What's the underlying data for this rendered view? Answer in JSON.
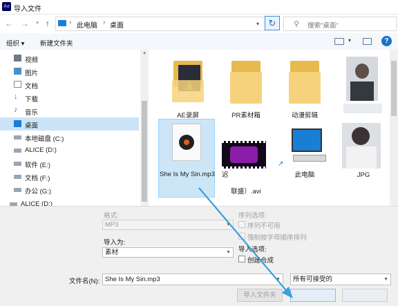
{
  "window": {
    "title": "导入文件",
    "app_icon_text": "Ae"
  },
  "address": {
    "crumbs": [
      "此电脑",
      "桌面"
    ],
    "separator": "›"
  },
  "search": {
    "placeholder": "搜索\"桌面\""
  },
  "toolbar": {
    "organize": "组织 ▾",
    "new_folder": "新建文件夹"
  },
  "sidebar": {
    "items": [
      {
        "label": "视频",
        "icon": "video-icon"
      },
      {
        "label": "图片",
        "icon": "pictures-icon"
      },
      {
        "label": "文档",
        "icon": "documents-icon"
      },
      {
        "label": "下载",
        "icon": "downloads-icon"
      },
      {
        "label": "音乐",
        "icon": "music-icon"
      },
      {
        "label": "桌面",
        "icon": "desktop-icon",
        "selected": true
      },
      {
        "label": "本地磁盘 (C:)",
        "icon": "drive-icon"
      },
      {
        "label": "ALICE (D:)",
        "icon": "drive-icon"
      },
      {
        "label": "软件 (E:)",
        "icon": "drive-icon"
      },
      {
        "label": "文档 (F:)",
        "icon": "drive-icon"
      },
      {
        "label": "办公 (G:)",
        "icon": "drive-icon"
      },
      {
        "label": "ALICE (D:)",
        "icon": "drive-icon"
      }
    ]
  },
  "files": [
    {
      "label": "AE录屏",
      "kind": "image-folder"
    },
    {
      "label": "PR素材箱",
      "kind": "folder"
    },
    {
      "label": "动漫剪辑",
      "kind": "folder"
    },
    {
      "label": "",
      "kind": "photo"
    },
    {
      "label": "She Is My Sin.mp3",
      "kind": "mp3",
      "selected": true
    },
    {
      "label": "迟",
      "label2": "联盛）.avi",
      "kind": "video"
    },
    {
      "label": "此电脑",
      "kind": "computer"
    },
    {
      "label": "JPG",
      "kind": "photo"
    }
  ],
  "options": {
    "format_label": "格式:",
    "format_value": "MP3",
    "import_as_label": "导入为:",
    "import_as_value": "素材",
    "sequence_options_label": "序列选项:",
    "sequence_checkbox": "序列不可用",
    "alpha_checkbox": "强制按字母顺序排列",
    "import_options_label": "导入选项:",
    "create_comp_checkbox": "创建合成"
  },
  "filename": {
    "label": "文件名(N):",
    "value": "She Is My Sin.mp3"
  },
  "filetype": {
    "value": "所有可接受的"
  },
  "buttons": {
    "import_folder": "导入文件夹"
  },
  "colors": {
    "accent": "#1a7fd4",
    "selection": "#cce4f7",
    "arrow": "#3aa0dc"
  }
}
